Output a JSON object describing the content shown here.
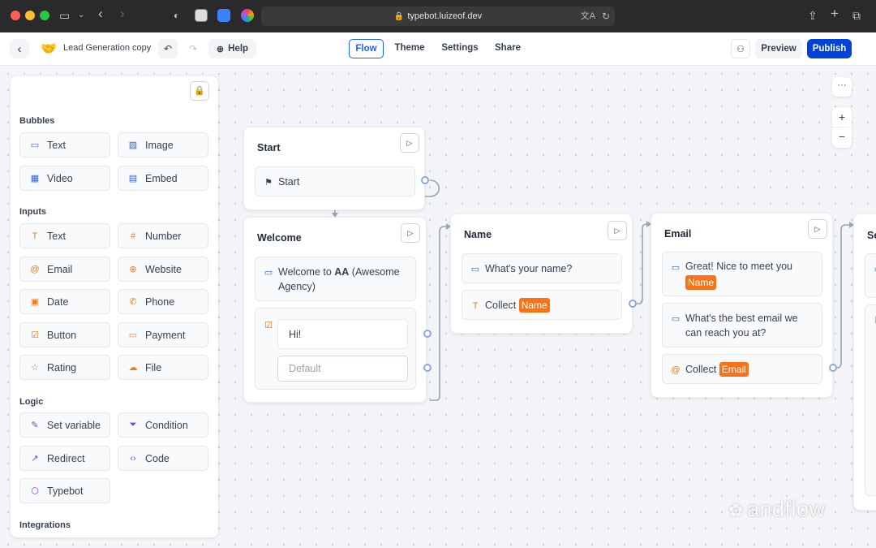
{
  "browser": {
    "url": "typebot.luizeof.dev",
    "icons": [
      "sidebar-icon",
      "chevron-down-icon",
      "back-icon",
      "forward-icon",
      "shield-icon",
      "notion-icon",
      "extension-icon",
      "color-wheel-icon",
      "translate-icon",
      "reload-icon",
      "share-icon",
      "new-tab-icon",
      "tabs-icon"
    ]
  },
  "header": {
    "doc_emoji": "🤝",
    "doc_title": "Lead Generation copy",
    "help_label": "Help",
    "tabs": [
      {
        "label": "Flow",
        "active": true
      },
      {
        "label": "Theme",
        "active": false
      },
      {
        "label": "Settings",
        "active": false
      },
      {
        "label": "Share",
        "active": false
      }
    ],
    "preview_label": "Preview",
    "publish_label": "Publish"
  },
  "sidebar": {
    "sections": {
      "bubbles": "Bubbles",
      "inputs": "Inputs",
      "logic": "Logic",
      "integrations": "Integrations"
    },
    "bubbles": [
      "Text",
      "Image",
      "Video",
      "Embed"
    ],
    "inputs": [
      "Text",
      "Number",
      "Email",
      "Website",
      "Date",
      "Phone",
      "Button",
      "Payment",
      "Rating",
      "File"
    ],
    "logic": [
      "Set variable",
      "Condition",
      "Redirect",
      "Code",
      "Typebot"
    ]
  },
  "nodes": {
    "start": {
      "title": "Start",
      "item": "Start"
    },
    "welcome": {
      "title": "Welcome",
      "text_prefix": "Welcome to ",
      "text_bold": "AA",
      "text_suffix": " (Awesome Agency)",
      "button_label": "Hi!",
      "default_label": "Default"
    },
    "name": {
      "title": "Name",
      "question": "What's your name?",
      "collect_label": "Collect",
      "variable": "Name"
    },
    "email": {
      "title": "Email",
      "greeting": "Great! Nice to meet you",
      "greeting_variable": "Name",
      "question": "What's the best email we can reach you at?",
      "collect_label": "Collect",
      "variable": "Email"
    },
    "partial": {
      "title": "Se"
    }
  },
  "controls": {
    "more": "···",
    "zoom_in": "+",
    "zoom_out": "−"
  },
  "watermark": "andflow",
  "colors": {
    "accent": "#0042da",
    "variable": "#f97316",
    "port": "#8aa7e0"
  }
}
